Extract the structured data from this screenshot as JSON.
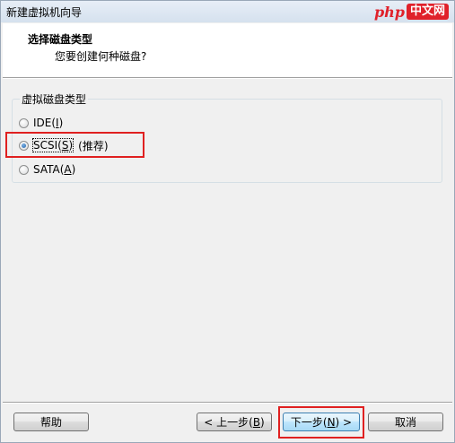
{
  "window": {
    "title": "新建虚拟机向导"
  },
  "watermark": {
    "brand": "php",
    "site": "中文网"
  },
  "header": {
    "title": "选择磁盘类型",
    "subtitle": "您要创建何种磁盘?"
  },
  "disk_type_group": {
    "legend": "虚拟磁盘类型",
    "options": [
      {
        "pre": "IDE(",
        "accel": "I",
        "post": ")",
        "hint": "",
        "selected": false
      },
      {
        "pre": "SCSI(",
        "accel": "S",
        "post": ")",
        "hint": "(推荐)",
        "selected": true
      },
      {
        "pre": "SATA(",
        "accel": "A",
        "post": ")",
        "hint": "",
        "selected": false
      }
    ]
  },
  "buttons": {
    "help": {
      "label": "帮助"
    },
    "back": {
      "pre": "< 上一步(",
      "accel": "B",
      "post": ")"
    },
    "next": {
      "pre": "下一步(",
      "accel": "N",
      "post": ") >"
    },
    "cancel": {
      "label": "取消"
    }
  },
  "colors": {
    "highlight_border": "#e02020",
    "window_bg": "#f0f0f0",
    "header_bg": "#ffffff"
  }
}
